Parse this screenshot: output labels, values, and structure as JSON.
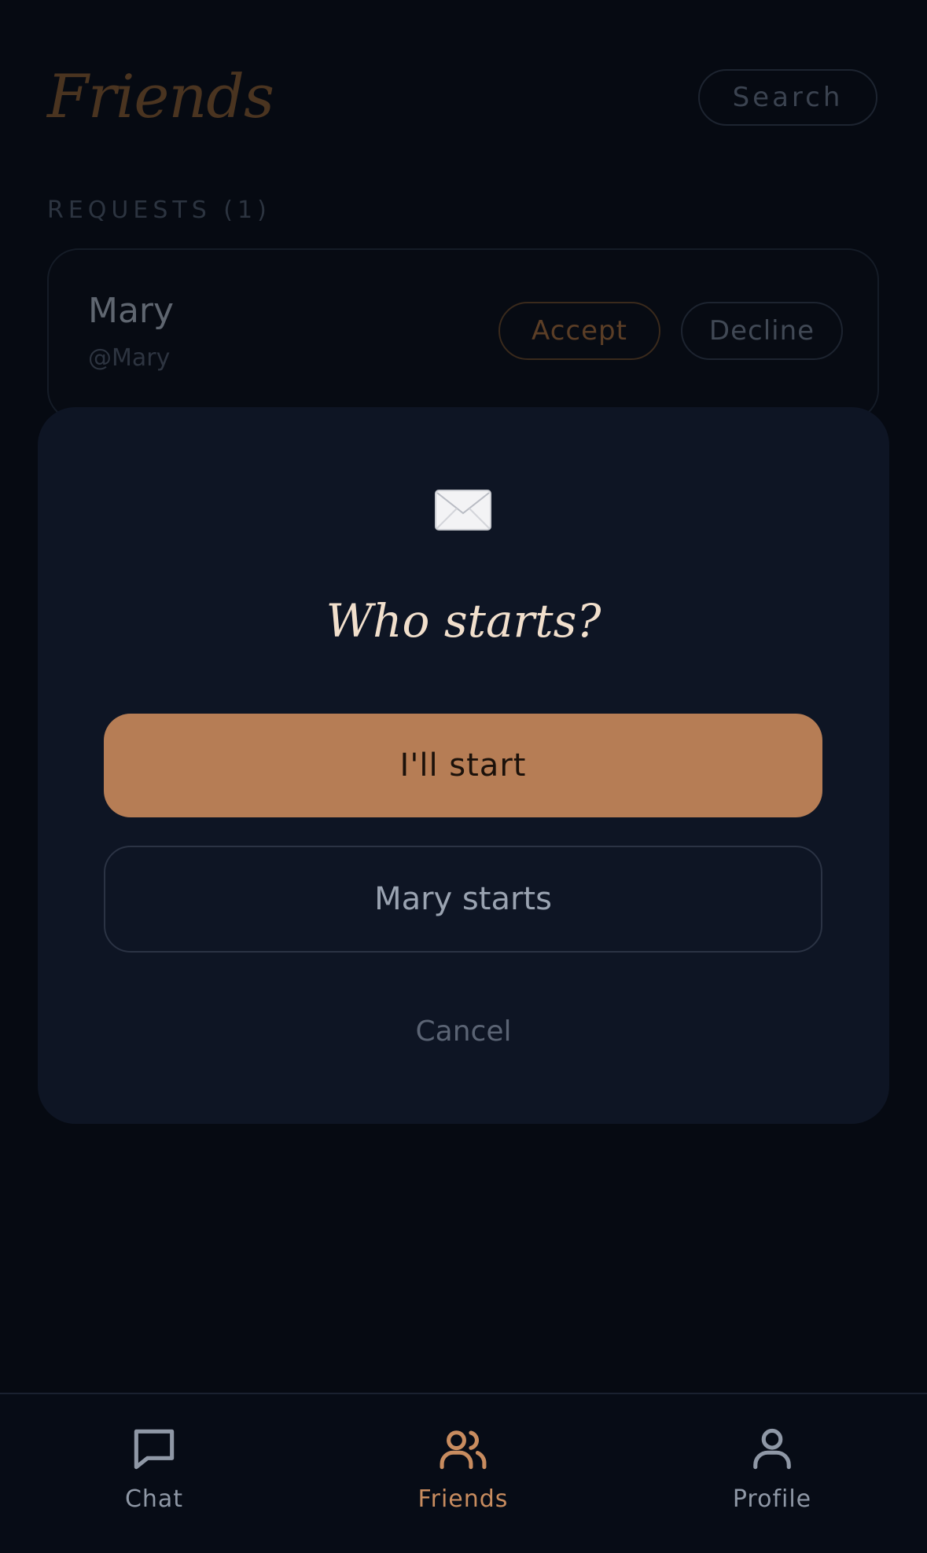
{
  "header": {
    "title": "Friends",
    "search_label": "Search"
  },
  "requests": {
    "section_label": "REQUESTS (1)",
    "items": [
      {
        "name": "Mary",
        "handle": "@Mary",
        "accept_label": "Accept",
        "decline_label": "Decline"
      }
    ]
  },
  "modal": {
    "icon": "envelope-icon",
    "title": "Who starts?",
    "primary_label": "I'll start",
    "secondary_label": "Mary starts",
    "cancel_label": "Cancel"
  },
  "nav": {
    "items": [
      {
        "label": "Chat",
        "icon": "chat-icon",
        "active": false
      },
      {
        "label": "Friends",
        "icon": "friends-icon",
        "active": true
      },
      {
        "label": "Profile",
        "icon": "profile-icon",
        "active": false
      }
    ]
  },
  "colors": {
    "accent": "#b67d55",
    "background": "#060a12",
    "modal": "#0e1524",
    "active_nav": "#c88c5f"
  }
}
